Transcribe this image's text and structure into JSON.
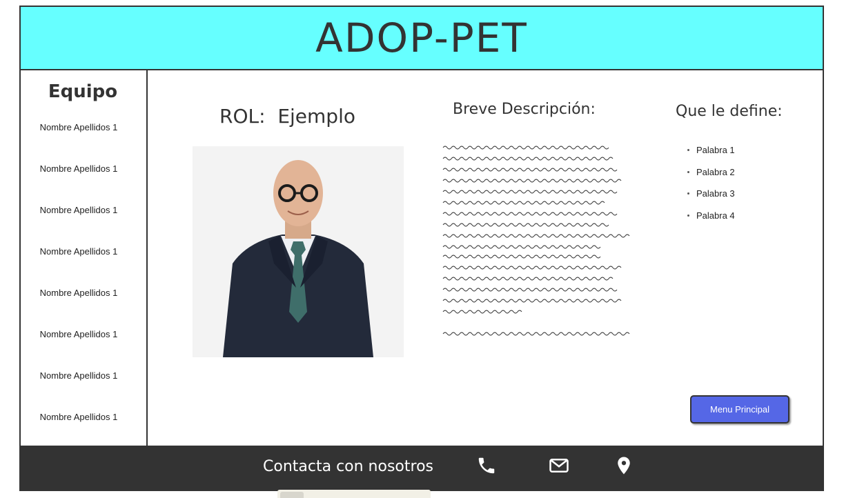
{
  "header": {
    "title": "ADOP-PET"
  },
  "sidebar": {
    "title": "Equipo",
    "members": [
      "Nombre Apellidos 1",
      "Nombre Apellidos 1",
      "Nombre Apellidos 1",
      "Nombre Apellidos 1",
      "Nombre Apellidos 1",
      "Nombre Apellidos 1",
      "Nombre Apellidos 1",
      "Nombre Apellidos 1"
    ]
  },
  "main": {
    "rol": "ROL:  Ejemplo",
    "description_title": "Breve Descripción:",
    "define_title": "Que le define:",
    "words": [
      "Palabra 1",
      "Palabra 2",
      "Palabra 3",
      "Palabra 4"
    ],
    "menu_button": "Menu Principal"
  },
  "footer": {
    "contact_label": "Contacta con nosotros",
    "icons": [
      "phone-icon",
      "mail-icon",
      "location-icon"
    ]
  },
  "colors": {
    "header_bg": "#66ffff",
    "footer_bg": "#333333",
    "button_bg": "#5567e6"
  }
}
